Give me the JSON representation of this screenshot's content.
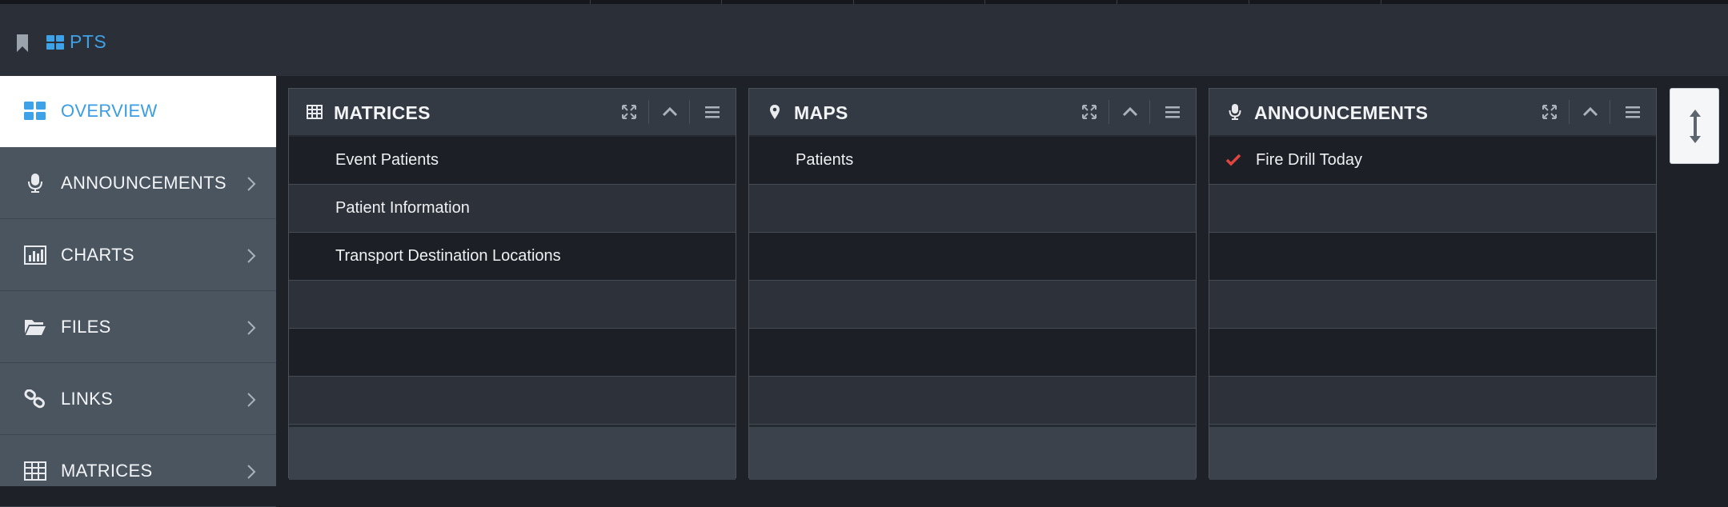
{
  "header": {
    "app_title": "PTS"
  },
  "sidebar": {
    "items": [
      {
        "label": "OVERVIEW",
        "icon": "grid-icon",
        "active": true
      },
      {
        "label": "ANNOUNCEMENTS",
        "icon": "microphone-icon"
      },
      {
        "label": "CHARTS",
        "icon": "bar-chart-icon"
      },
      {
        "label": "FILES",
        "icon": "folder-open-icon"
      },
      {
        "label": "LINKS",
        "icon": "link-icon"
      },
      {
        "label": "MATRICES",
        "icon": "table-icon"
      }
    ]
  },
  "panels": {
    "matrices": {
      "title": "MATRICES",
      "icon": "table-icon",
      "rows": [
        "Event Patients",
        "Patient Information",
        "Transport Destination Locations"
      ]
    },
    "maps": {
      "title": "MAPS",
      "icon": "map-marker-icon",
      "rows": [
        "Patients"
      ]
    },
    "announcements": {
      "title": "ANNOUNCEMENTS",
      "icon": "microphone-icon",
      "rows": [
        "Fire Drill Today"
      ]
    }
  },
  "colors": {
    "accent": "#3ea2e8",
    "check": "#e0453f",
    "sidebar": "#4b5560",
    "background": "#1e2128"
  }
}
